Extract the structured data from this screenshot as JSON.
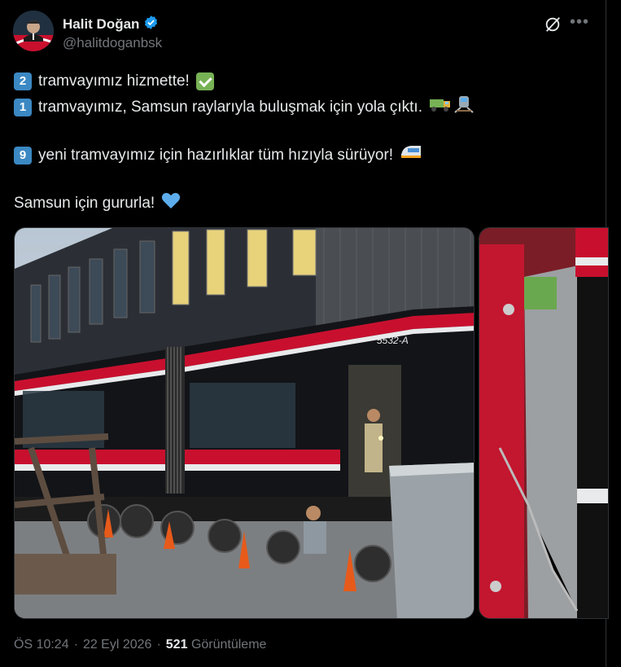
{
  "author": {
    "name": "Halit Doğan",
    "handle": "@halitdoganbsk",
    "verified_color": "#1d9bf0"
  },
  "icons": [
    "grok-icon",
    "more-icon",
    "verified-badge-icon",
    "check-mark-icon",
    "truck-icon",
    "railway-icon",
    "tram-icon",
    "blue-heart-icon"
  ],
  "tweet": {
    "line1_num": "2",
    "line1_text": "tramvayımız hizmette!",
    "line2_num": "1",
    "line2_text": "tramvayımız, Samsun raylarıyla buluşmak için yola çıktı.",
    "line3_num": "9",
    "line3_text": "yeni tramvayımız için hazırlıklar tüm hızıyla sürüyor!",
    "line4_text": "Samsun için gururla!"
  },
  "photo": {
    "tram_number": "5532-A"
  },
  "meta": {
    "time": "ÖS 10:24",
    "date": "22 Eyl 2026",
    "sep": "·",
    "views": "521",
    "views_label": "Görüntüleme"
  }
}
